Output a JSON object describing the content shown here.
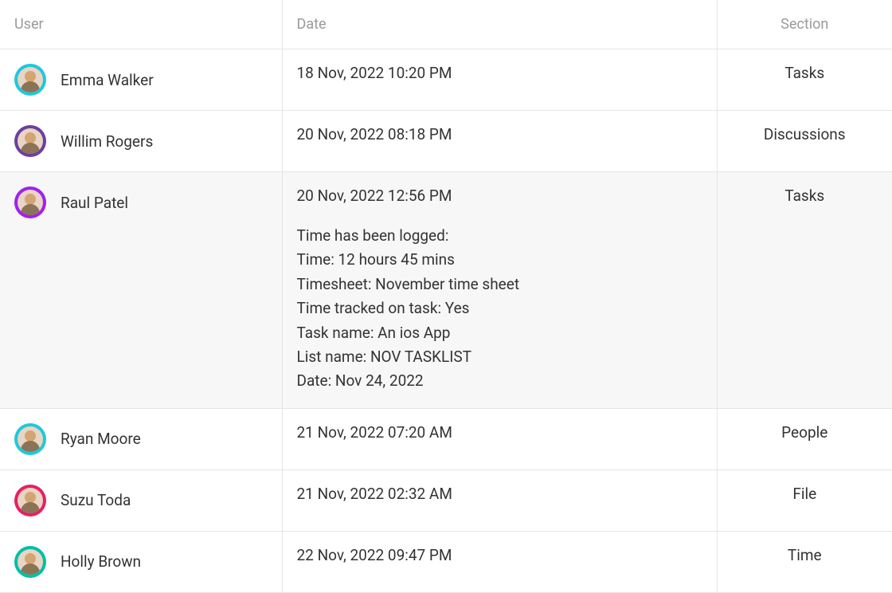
{
  "headers": {
    "user": "User",
    "date": "Date",
    "section": "Section"
  },
  "rows": [
    {
      "user": "Emma Walker",
      "avatarColor": "#1fc8db",
      "date": "18 Nov, 2022 10:20 PM",
      "section": "Tasks",
      "expanded": false
    },
    {
      "user": "Willim Rogers",
      "avatarColor": "#6b3fa0",
      "date": "20 Nov, 2022  08:18 PM",
      "section": "Discussions",
      "expanded": false
    },
    {
      "user": "Raul Patel",
      "avatarColor": "#a020f0",
      "date": "20 Nov, 2022  12:56 PM",
      "section": "Tasks",
      "expanded": true,
      "details": [
        "Time has been logged:",
        "Time: 12 hours 45 mins",
        "Timesheet: November time sheet",
        "Time tracked on task: Yes",
        "Task name: An ios App",
        "List name: NOV TASKLIST",
        "Date: Nov 24, 2022"
      ]
    },
    {
      "user": "Ryan Moore",
      "avatarColor": "#1fc8db",
      "date": "21 Nov, 2022  07:20 AM",
      "section": "People",
      "expanded": false
    },
    {
      "user": "Suzu Toda",
      "avatarColor": "#e91e63",
      "date": "21 Nov, 2022  02:32 AM",
      "section": "File",
      "expanded": false
    },
    {
      "user": "Holly Brown",
      "avatarColor": "#00bfa5",
      "date": "22 Nov, 2022  09:47 PM",
      "section": "Time",
      "expanded": false
    }
  ]
}
